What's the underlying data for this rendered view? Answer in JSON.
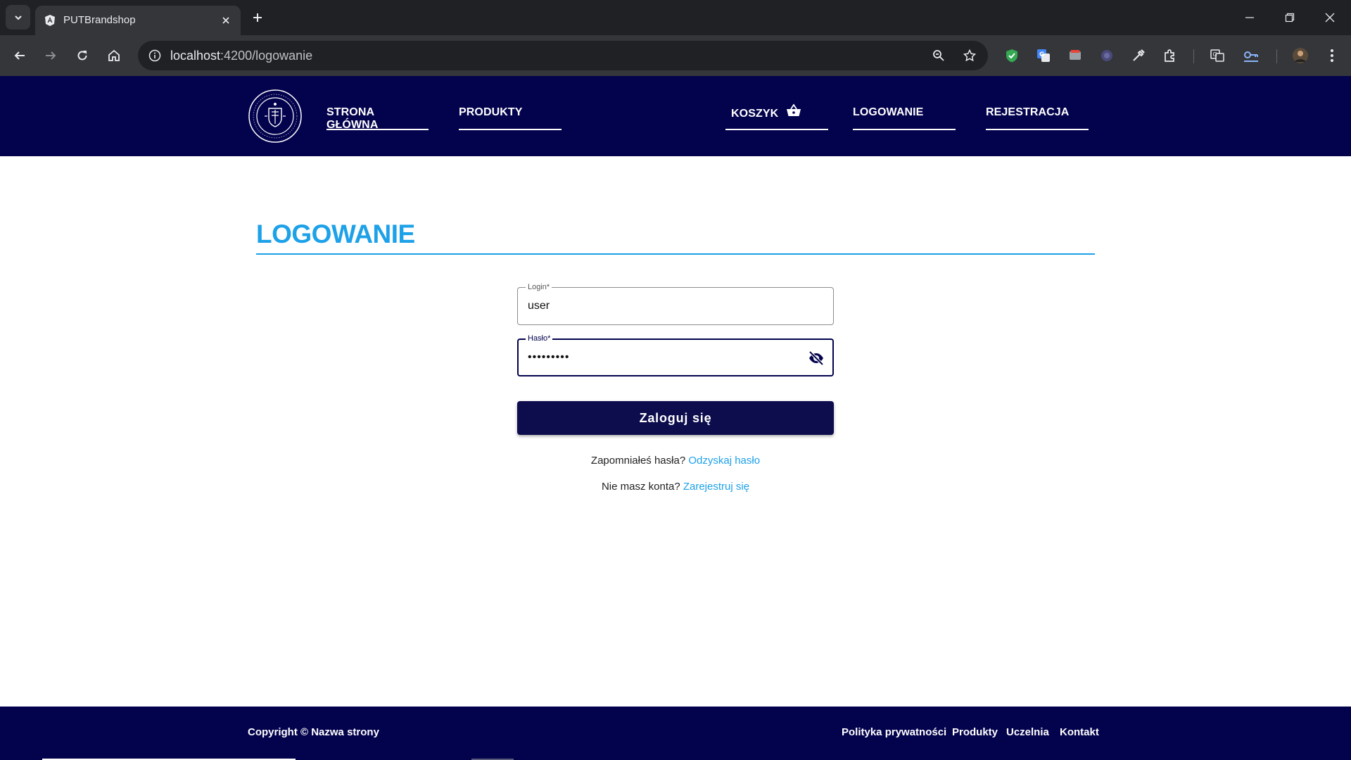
{
  "browser": {
    "tab_title": "PUTBrandshop",
    "url_host": "localhost",
    "url_path": ":4200/logowanie"
  },
  "nav": {
    "home": "STRONA GŁÓWNA",
    "products": "PRODUKTY",
    "cart": "KOSZYK",
    "login": "LOGOWANIE",
    "register": "REJESTRACJA"
  },
  "page": {
    "title": "LOGOWANIE"
  },
  "form": {
    "login_label": "Login*",
    "login_value": "user",
    "password_label": "Hasło*",
    "password_value": "•••••••••",
    "submit_label": "Zaloguj się",
    "forgot_text": "Zapomniałeś hasła?",
    "forgot_link": "Odzyskaj hasło",
    "no_account_text": "Nie masz konta?",
    "register_link": "Zarejestruj się"
  },
  "footer": {
    "copyright": "Copyright © Nazwa strony",
    "links": [
      "Polityka prywatności",
      "Produkty",
      "Uczelnia",
      "Kontakt"
    ]
  },
  "colors": {
    "header_bg": "#03024d",
    "accent": "#1da1e8",
    "button_bg": "#0d0c4d"
  }
}
